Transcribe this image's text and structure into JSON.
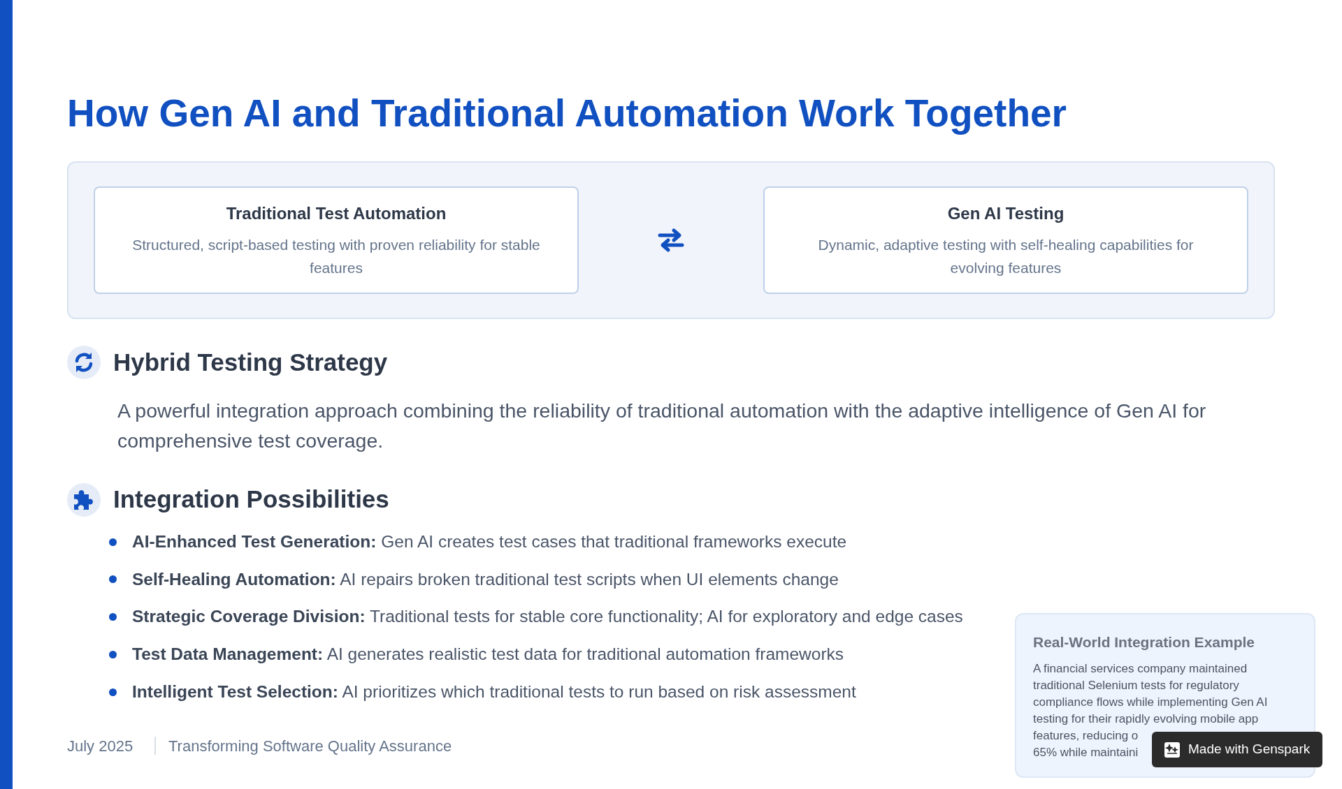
{
  "title": "How Gen AI and Traditional Automation Work Together",
  "comparison": [
    {
      "title": "Traditional Test Automation",
      "description": "Structured, script-based testing with proven reliability for stable features"
    },
    {
      "title": "Gen AI Testing",
      "description": "Dynamic, adaptive testing with self-healing capabilities for evolving features"
    }
  ],
  "hybrid": {
    "heading": "Hybrid Testing Strategy",
    "text": "A powerful integration approach combining the reliability of traditional automation with the adaptive intelligence of Gen AI for comprehensive test coverage."
  },
  "integration": {
    "heading": "Integration Possibilities",
    "items": [
      {
        "label": "AI-Enhanced Test Generation:",
        "text": "Gen AI creates test cases that traditional frameworks execute"
      },
      {
        "label": "Self-Healing Automation:",
        "text": "AI repairs broken traditional test scripts when UI elements change"
      },
      {
        "label": "Strategic Coverage Division:",
        "text": "Traditional tests for stable core functionality; AI for exploratory and edge cases"
      },
      {
        "label": "Test Data Management:",
        "text": "AI generates realistic test data for traditional automation frameworks"
      },
      {
        "label": "Intelligent Test Selection:",
        "text": "AI prioritizes which traditional tests to run based on risk assessment"
      }
    ]
  },
  "example": {
    "title": "Real-World Integration Example",
    "lines": [
      "A financial services company maintained",
      "traditional Selenium tests for regulatory",
      "compliance flows while implementing Gen AI",
      "testing for their rapidly evolving mobile app"
    ],
    "partial_lines": [
      "features, reducing o",
      "65% while maintaini"
    ]
  },
  "footer": {
    "date": "July 2025",
    "subtitle": "Transforming Software Quality Assurance"
  },
  "badge": {
    "label": "Made with Genspark"
  }
}
